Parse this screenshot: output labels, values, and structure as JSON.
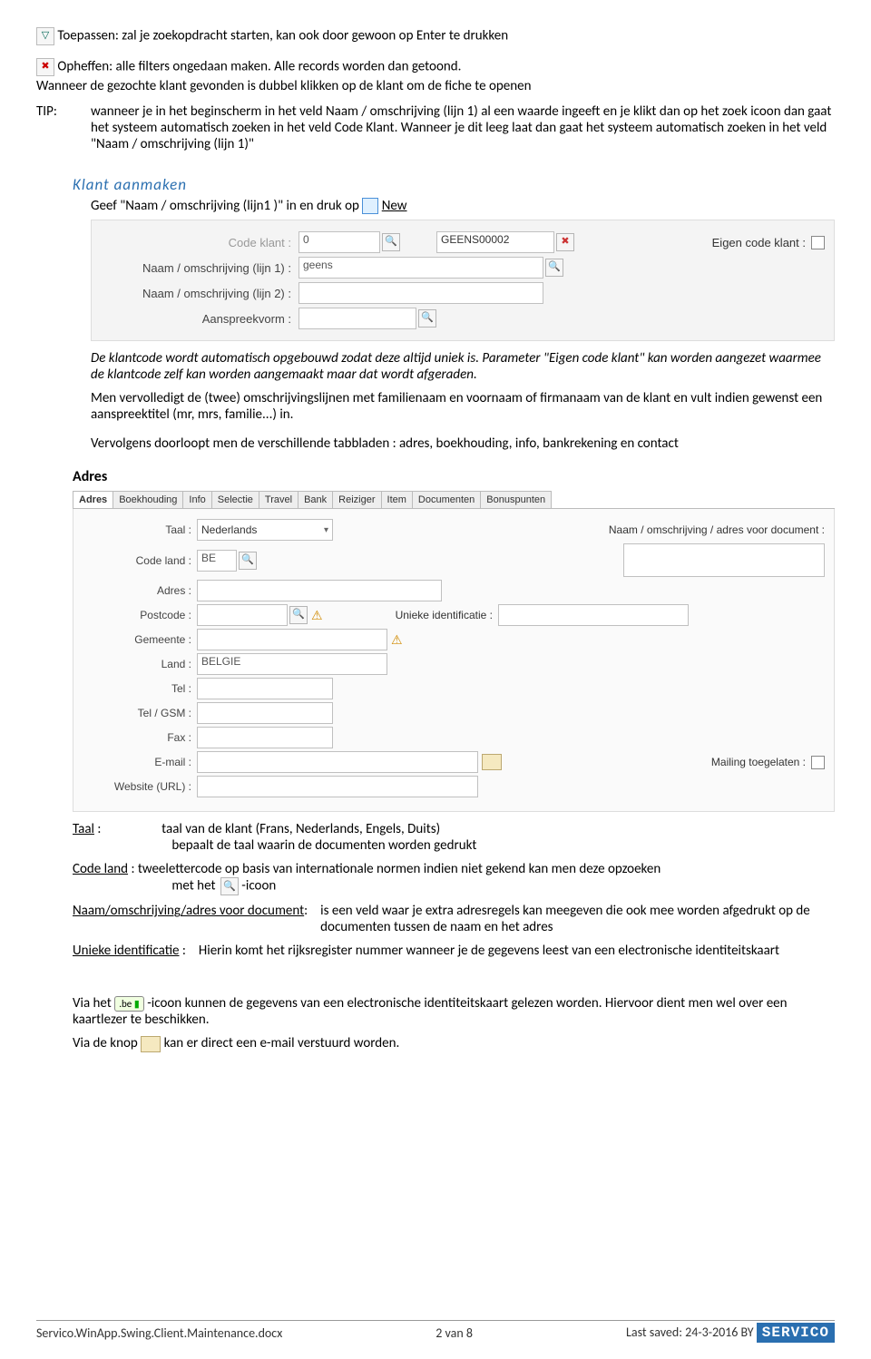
{
  "top": {
    "toepassen": "Toepassen: zal je zoekopdracht starten, kan ook door gewoon op Enter te drukken",
    "opheffen": "Opheffen: alle filters ongedaan maken.  Alle records worden dan getoond.",
    "wanneer_dubbel": "Wanneer de gezochte klant gevonden is dubbel klikken op de klant om de fiche te openen"
  },
  "tip": {
    "label": "TIP:",
    "text": "wanneer je in het beginscherm in het veld Naam / omschrijving (lijn 1) al een waarde ingeeft en je klikt dan op het zoek icoon dan gaat het systeem automatisch zoeken in het veld Code Klant.  Wanneer je dit leeg laat dan gaat het systeem automatisch zoeken in het veld \"Naam / omschrijving (lijn 1)\""
  },
  "klant_aanmaken": {
    "heading": "Klant aanmaken",
    "intro_prefix": "Geef \"Naam / omschrijving (lijn1 )\" in en druk op ",
    "intro_suffix": "New"
  },
  "form1": {
    "code_klant_label": "Code klant :",
    "code_klant_value": "0",
    "generated_code": "GEENS00002",
    "eigen_code_label": "Eigen code klant :",
    "naam1_label": "Naam / omschrijving (lijn 1) :",
    "naam1_value": "geens",
    "naam2_label": "Naam / omschrijving (lijn 2) :",
    "aanspreek_label": "Aanspreekvorm :"
  },
  "after_form1": {
    "p1": "De klantcode wordt automatisch opgebouwd zodat deze altijd uniek is.  Parameter \"Eigen code klant\" kan worden aangezet waarmee de klantcode zelf kan worden aangemaakt maar dat wordt afgeraden.",
    "p2": "Men vervolledigt de (twee) omschrijvingslijnen met familienaam en voornaam of firmanaam van de klant en vult indien gewenst een aanspreektitel (mr, mrs, familie...) in.",
    "p3": "Vervolgens doorloopt men de verschillende tabbladen : adres, boekhouding, info, bankrekening en contact"
  },
  "adres_heading": "Adres",
  "tabs": [
    "Adres",
    "Boekhouding",
    "Info",
    "Selectie",
    "Travel",
    "Bank",
    "Reiziger",
    "Item",
    "Documenten",
    "Bonuspunten"
  ],
  "form2": {
    "taal_label": "Taal :",
    "taal_value": "Nederlands",
    "doc_label": "Naam / omschrijving / adres voor document :",
    "code_land_label": "Code land :",
    "code_land_value": "BE",
    "adres_label": "Adres :",
    "postcode_label": "Postcode :",
    "unieke_label": "Unieke identificatie :",
    "gemeente_label": "Gemeente :",
    "land_label": "Land :",
    "land_value": "BELGIE",
    "tel_label": "Tel :",
    "telgsm_label": "Tel / GSM :",
    "fax_label": "Fax :",
    "email_label": "E-mail :",
    "mailing_label": "Mailing toegelaten :",
    "website_label": "Website (URL) :"
  },
  "defs": {
    "taal_t": "Taal",
    "taal_colon": " :",
    "taal_def": "taal van de klant (Frans, Nederlands, Engels, Duits)",
    "taal_def2": "bepaalt de taal waarin de documenten worden gedrukt",
    "codeland_t": "Code land",
    "codeland_def1": " :  tweelettercode op basis van internationale normen indien niet gekend kan men deze opzoeken",
    "codeland_def2_pre": "met het ",
    "codeland_def2_post": "-icoon",
    "naamdoc_t": "Naam/omschrijving/adres voor document",
    "naamdoc_colon": ":",
    "naamdoc_def": "is een veld waar je extra adresregels kan meegeven die ook mee worden afgedrukt op de documenten tussen de naam en het adres",
    "unieke_t": "Unieke identificatie",
    "unieke_colon": " :",
    "unieke_def": "Hierin komt het rijksregister nummer wanneer je de gegevens leest van een electronische identiteitskaart"
  },
  "bottom": {
    "via_be_pre": "Via het ",
    "via_be_post": "-icoon kunnen de gegevens van een electronische identiteitskaart gelezen worden.  Hiervoor dient men wel over een kaartlezer te beschikken.",
    "via_env_pre": "Via de knop ",
    "via_env_post": " kan er direct een e-mail verstuurd worden."
  },
  "footer": {
    "file": "Servico.WinApp.Swing.Client.Maintenance.docx",
    "page": "2 van 8",
    "saved": "Last saved: 24-3-2016 BY",
    "logo": "SERVICO"
  }
}
